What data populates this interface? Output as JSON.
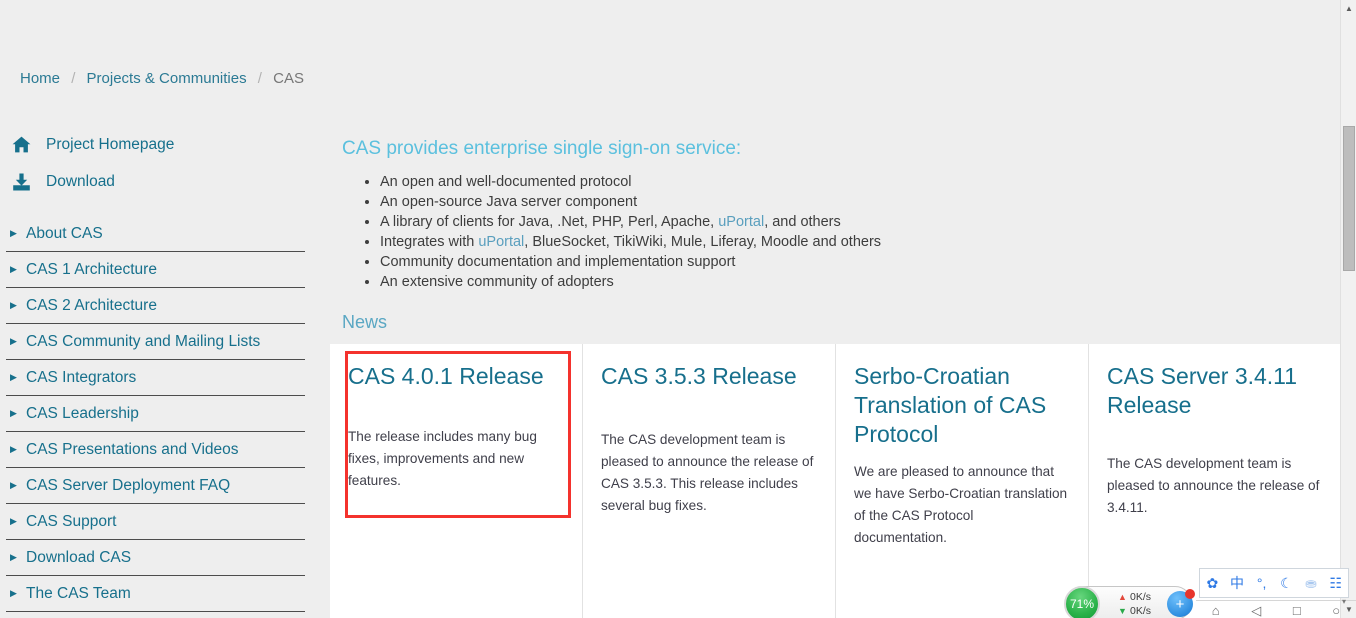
{
  "breadcrumb": {
    "items": [
      {
        "label": "Home",
        "current": false
      },
      {
        "label": "Projects & Communities",
        "current": false
      },
      {
        "label": "CAS",
        "current": true
      }
    ],
    "separator": "/"
  },
  "sidebar": {
    "links": [
      {
        "label": "Project Homepage",
        "icon": "home-icon"
      },
      {
        "label": "Download",
        "icon": "download-icon"
      }
    ],
    "nav_items": [
      {
        "label": "About CAS"
      },
      {
        "label": "CAS 1 Architecture"
      },
      {
        "label": "CAS 2 Architecture"
      },
      {
        "label": "CAS Community and Mailing Lists"
      },
      {
        "label": "CAS Integrators"
      },
      {
        "label": "CAS Leadership"
      },
      {
        "label": "CAS Presentations and Videos"
      },
      {
        "label": "CAS Server Deployment FAQ"
      },
      {
        "label": "CAS Support"
      },
      {
        "label": "Download CAS"
      },
      {
        "label": "The CAS Team"
      }
    ],
    "caret_glyph": "▶"
  },
  "main": {
    "lead_heading": "CAS provides enterprise single sign-on service:",
    "features": [
      {
        "parts": [
          {
            "text": "An open and well-documented protocol",
            "link": false
          }
        ]
      },
      {
        "parts": [
          {
            "text": "An open-source Java server component",
            "link": false
          }
        ]
      },
      {
        "parts": [
          {
            "text": "A library of clients for Java, .Net, PHP, Perl, Apache, ",
            "link": false
          },
          {
            "text": "uPortal",
            "link": true
          },
          {
            "text": ", and others",
            "link": false
          }
        ]
      },
      {
        "parts": [
          {
            "text": "Integrates with ",
            "link": false
          },
          {
            "text": "uPortal",
            "link": true
          },
          {
            "text": ", BlueSocket, TikiWiki, Mule, Liferay, Moodle and others",
            "link": false
          }
        ]
      },
      {
        "parts": [
          {
            "text": "Community documentation and implementation support",
            "link": false
          }
        ]
      },
      {
        "parts": [
          {
            "text": "An extensive community of adopters",
            "link": false
          }
        ]
      }
    ],
    "news_heading": "News",
    "news_cards": [
      {
        "title": "CAS 4.0.1 Release",
        "body": "The release includes many bug fixes, improvements and new features.",
        "highlighted": true
      },
      {
        "title": "CAS 3.5.3 Release",
        "body": "The CAS development team is pleased to announce the release of CAS 3.5.3. This release includes several bug fixes.",
        "highlighted": false
      },
      {
        "title": "Serbo-Croatian Translation of CAS Protocol",
        "body": "We are pleased to announce that we have Serbo-Croatian translation of the CAS Protocol documentation.",
        "highlighted": false
      },
      {
        "title": "CAS Server 3.4.11 Release",
        "body": "The CAS development team is pleased to announce the release of 3.4.11.",
        "highlighted": false
      }
    ]
  },
  "scrollbar": {
    "up_glyph": "▲",
    "down_glyph": "▼"
  },
  "widgets": {
    "network_monitor": {
      "cpu_percent": "71%",
      "upload_arrow": "▲",
      "download_arrow": "▼",
      "upload_rate": "0K/s",
      "download_rate": "0K/s",
      "badge_glyph": "+"
    },
    "ime_toolbar": {
      "buttons": [
        {
          "glyph": "✿",
          "name": "paw-logo-icon"
        },
        {
          "glyph": "中",
          "name": "chinese-mode-icon"
        },
        {
          "glyph": "°,",
          "name": "punctuation-mode-icon"
        },
        {
          "glyph": "☾",
          "name": "crescent-moon-icon"
        },
        {
          "glyph": "⛂",
          "name": "user-icon"
        },
        {
          "glyph": "☷",
          "name": "grid-menu-icon"
        }
      ],
      "expand_glyph": "▾"
    },
    "taskbar_icons": [
      {
        "glyph": "⌂",
        "name": "taskbar-icon-1"
      },
      {
        "glyph": "◁",
        "name": "taskbar-icon-2"
      },
      {
        "glyph": "□",
        "name": "taskbar-icon-3"
      },
      {
        "glyph": "○",
        "name": "taskbar-icon-4"
      }
    ]
  },
  "colors": {
    "page_bg": "#eeeeee",
    "link_teal": "#16708c",
    "heading_light_blue": "#5bc0de",
    "highlight_red": "#f4322d",
    "card_bg": "#ffffff"
  }
}
